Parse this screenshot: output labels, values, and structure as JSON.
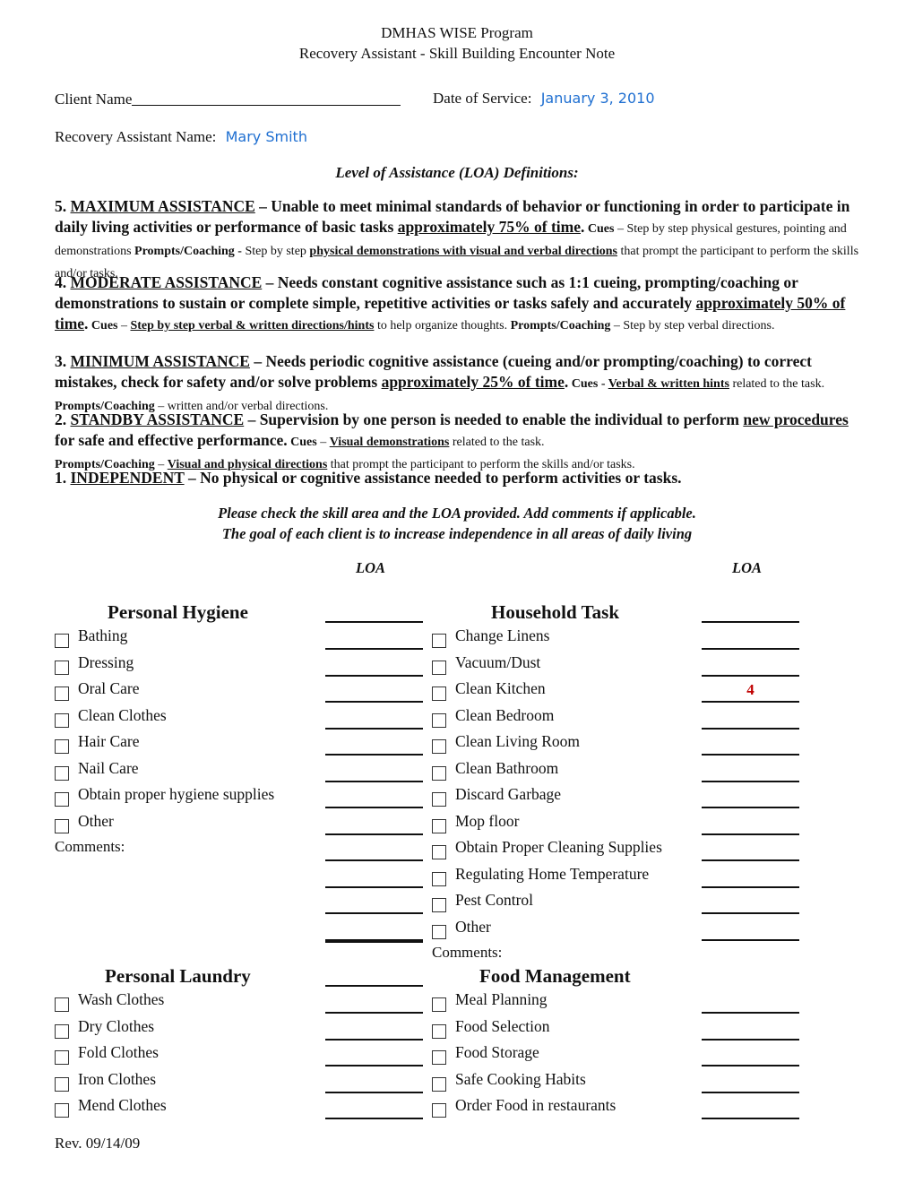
{
  "header": {
    "program": "DMHAS WISE Program",
    "subtitle": "Recovery Assistant - Skill Building Encounter Note"
  },
  "fields": {
    "client_name_label": "Client Name",
    "client_name_value": "",
    "date_label": "Date of Service:",
    "date_value": "January 3, 2010",
    "ra_label": "Recovery Assistant Name:",
    "ra_value": "Mary Smith"
  },
  "definitions": {
    "title": "Level of Assistance (LOA) Definitions:",
    "level5": {
      "num": "5.",
      "name": "MAXIMUM ASSISTANCE",
      "desc_a": " – Unable to meet minimal standards of behavior or functioning in order to participate in daily living activities or performance of basic tasks ",
      "pct": "approximately 75% of time",
      "dot": ".",
      "cues_label": " Cues",
      "cues_text": " – Step by step physical gestures, pointing and demonstrations ",
      "prompts_label": "Prompts/Coaching - ",
      "prompts_text_a": "Step by step ",
      "prompts_ul": "physical demonstrations with visual and verbal directions",
      "prompts_text_b": " that prompt the participant to perform the skills and/or tasks."
    },
    "level4": {
      "num": "4. ",
      "name": "MODERATE ASSISTANCE",
      "desc_a": " – Needs constant cognitive assistance such as 1:1 cueing, prompting/coaching or demonstrations to sustain or complete simple, repetitive activities or tasks safely and accurately ",
      "pct": "approximately 50% of time",
      "dot": ".",
      "cues_label": " Cues",
      "cues_dash": " – ",
      "cues_ul": "Step by step verbal & written directions/hints",
      "cues_text": " to help organize thoughts. ",
      "prompts_label": "Prompts/Coaching",
      "prompts_text": " – Step by step verbal directions."
    },
    "level3": {
      "num": "3. ",
      "name": "MINIMUM ASSISTANCE",
      "desc_a": " – Needs periodic cognitive assistance (cueing and/or prompting/coaching) to correct mistakes, check for safety and/or solve problems ",
      "pct": "approximately 25% of time",
      "dot": ".",
      "cues_label": " Cues - ",
      "cues_ul": "Verbal & written hints",
      "cues_text": " related to the task. ",
      "prompts_label": "Prompts/Coaching",
      "prompts_text": " – written and/or verbal directions."
    },
    "level2": {
      "num": "2. ",
      "name": "STANDBY ASSISTANCE",
      "desc_a": " – Supervision by one person is needed to enable the individual to perform ",
      "desc_ul": "new procedures",
      "desc_b": " for safe and effective performance.",
      "cues_label": " Cues",
      "cues_dash": " – ",
      "cues_ul": "Visual demonstrations",
      "cues_text": " related to the task.",
      "prompts_label": "Prompts/Coaching",
      "prompts_dash": " – ",
      "prompts_ul": "Visual and physical directions",
      "prompts_text": " that prompt the participant to perform the skills and/or tasks."
    },
    "level1": {
      "num": "1. ",
      "name": "INDEPENDENT",
      "desc": " – No physical or cognitive assistance needed to perform activities or tasks."
    }
  },
  "instructions": {
    "line1": "Please check the skill area and the LOA provided.  Add comments if applicable.",
    "line2": "The goal of each client is to increase independence in all areas of daily living",
    "loa_left": "LOA",
    "loa_right": "LOA"
  },
  "sections": {
    "personal_hygiene": {
      "title": "Personal Hygiene",
      "items": [
        {
          "label": "Bathing",
          "checked": false,
          "loa": ""
        },
        {
          "label": "Dressing",
          "checked": false,
          "loa": ""
        },
        {
          "label": "Oral Care",
          "checked": false,
          "loa": ""
        },
        {
          "label": "Clean Clothes",
          "checked": false,
          "loa": ""
        },
        {
          "label": "Hair Care",
          "checked": false,
          "loa": ""
        },
        {
          "label": "Nail Care",
          "checked": false,
          "loa": ""
        },
        {
          "label": "Obtain proper hygiene supplies",
          "checked": false,
          "loa": ""
        },
        {
          "label": "Other",
          "checked": false,
          "loa": ""
        }
      ],
      "comments_label": "Comments:"
    },
    "household_task": {
      "title": "Household Task",
      "items": [
        {
          "label": "Change Linens",
          "checked": false,
          "loa": ""
        },
        {
          "label": "Vacuum/Dust",
          "checked": false,
          "loa": ""
        },
        {
          "label": "Clean Kitchen",
          "checked": false,
          "loa": "4"
        },
        {
          "label": "Clean Bedroom",
          "checked": false,
          "loa": ""
        },
        {
          "label": "Clean Living Room",
          "checked": false,
          "loa": ""
        },
        {
          "label": "Clean Bathroom",
          "checked": false,
          "loa": ""
        },
        {
          "label": "Discard Garbage",
          "checked": false,
          "loa": ""
        },
        {
          "label": "Mop floor",
          "checked": false,
          "loa": ""
        },
        {
          "label": "Obtain Proper Cleaning Supplies",
          "checked": false,
          "loa": ""
        },
        {
          "label": "Regulating Home Temperature",
          "checked": false,
          "loa": ""
        },
        {
          "label": "Pest Control",
          "checked": false,
          "loa": ""
        },
        {
          "label": "Other",
          "checked": false,
          "loa": ""
        }
      ],
      "comments_label": "Comments:"
    },
    "personal_laundry": {
      "title": "Personal Laundry",
      "items": [
        {
          "label": "Wash Clothes",
          "checked": false,
          "loa": ""
        },
        {
          "label": "Dry Clothes",
          "checked": false,
          "loa": ""
        },
        {
          "label": "Fold Clothes",
          "checked": false,
          "loa": ""
        },
        {
          "label": "Iron Clothes",
          "checked": false,
          "loa": ""
        },
        {
          "label": "Mend Clothes",
          "checked": false,
          "loa": ""
        }
      ]
    },
    "food_management": {
      "title": "Food Management",
      "items": [
        {
          "label": "Meal Planning",
          "checked": false,
          "loa": ""
        },
        {
          "label": "Food Selection",
          "checked": false,
          "loa": ""
        },
        {
          "label": "Food Storage",
          "checked": false,
          "loa": ""
        },
        {
          "label": "Safe Cooking Habits",
          "checked": false,
          "loa": ""
        },
        {
          "label": "Order Food in restaurants",
          "checked": false,
          "loa": ""
        }
      ]
    }
  },
  "footer": {
    "revision": "Rev. 09/14/09"
  },
  "colors": {
    "handwritten": "#1f6fd1",
    "loa_value": "#c00000"
  }
}
